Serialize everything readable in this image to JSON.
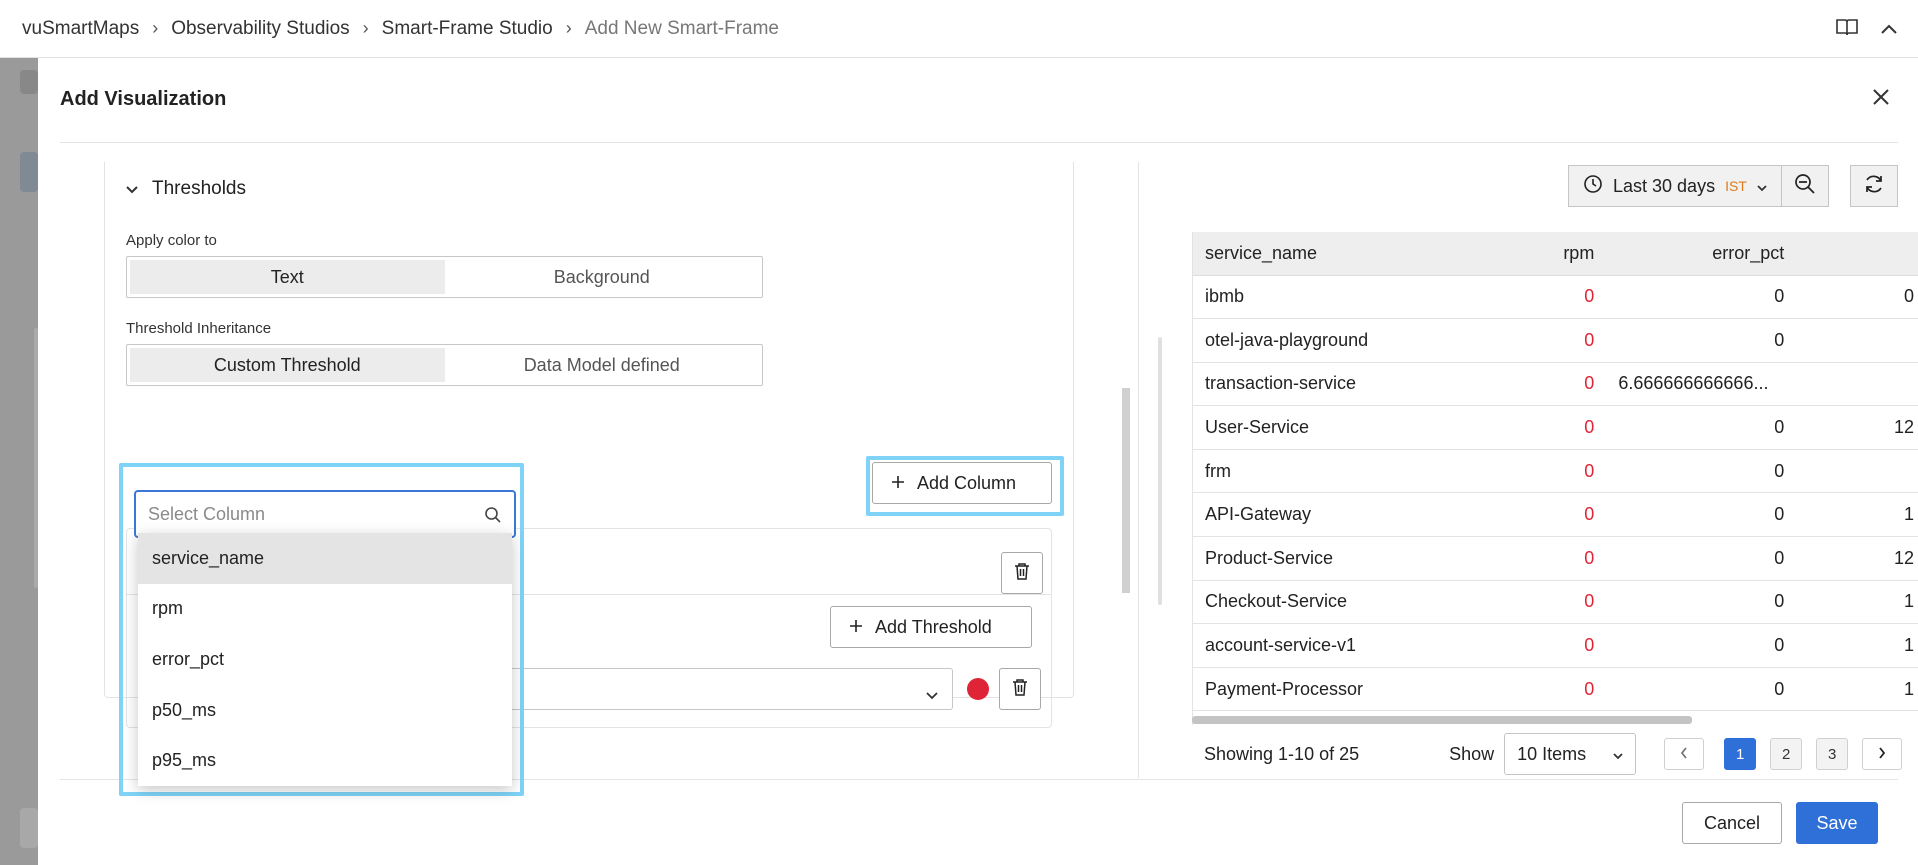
{
  "breadcrumb": {
    "items": [
      "vuSmartMaps",
      "Observability Studios",
      "Smart-Frame Studio"
    ],
    "current": "Add New Smart-Frame"
  },
  "modal": {
    "title": "Add Visualization"
  },
  "thresholds": {
    "section_title": "Thresholds",
    "apply_color_label": "Apply color to",
    "apply_color_options": [
      "Text",
      "Background"
    ],
    "inheritance_label": "Threshold Inheritance",
    "inheritance_options": [
      "Custom Threshold",
      "Data Model defined"
    ],
    "add_column_label": "Add Column",
    "add_threshold_label": "Add Threshold",
    "threshold_color": "#e02437"
  },
  "column_dropdown": {
    "placeholder": "Select Column",
    "options": [
      "service_name",
      "rpm",
      "error_pct",
      "p50_ms",
      "p95_ms"
    ],
    "highlighted_index": 0
  },
  "time_picker": {
    "label": "Last 30 days",
    "timezone": "IST"
  },
  "table": {
    "columns": [
      "service_name",
      "rpm",
      "error_pct",
      ""
    ],
    "rows": [
      [
        "ibmb",
        "0",
        "0",
        "0"
      ],
      [
        "otel-java-playground",
        "0",
        "0",
        ""
      ],
      [
        "transaction-service",
        "0",
        "6.666666666666...",
        ""
      ],
      [
        "User-Service",
        "0",
        "0",
        "12"
      ],
      [
        "frm",
        "0",
        "0",
        ""
      ],
      [
        "API-Gateway",
        "0",
        "0",
        "1"
      ],
      [
        "Product-Service",
        "0",
        "0",
        "12"
      ],
      [
        "Checkout-Service",
        "0",
        "0",
        "1"
      ],
      [
        "account-service-v1",
        "0",
        "0",
        "1"
      ],
      [
        "Payment-Processor",
        "0",
        "0",
        "1"
      ]
    ]
  },
  "pagination": {
    "summary": "Showing 1-10 of 25",
    "show_label": "Show",
    "page_size": "10 Items",
    "pages": [
      "1",
      "2",
      "3"
    ],
    "current_page": "1"
  },
  "footer": {
    "cancel_label": "Cancel",
    "save_label": "Save"
  },
  "colors": {
    "accent": "#2f6fd8",
    "highlight_outline": "#7fd3f7",
    "zero_value_red": "#e02437",
    "timezone_orange": "#e07a1a"
  }
}
